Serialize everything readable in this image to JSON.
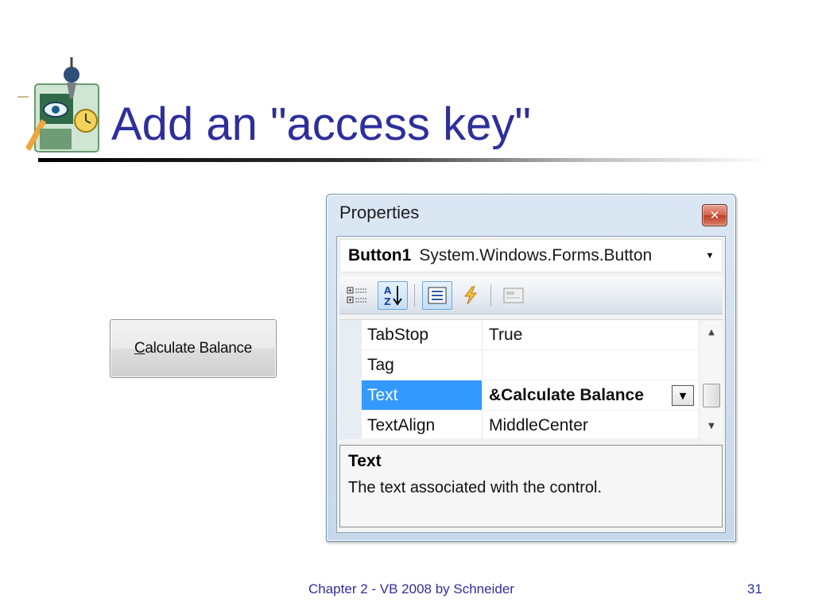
{
  "slide": {
    "title": "Add an \"access key\"",
    "footer": "Chapter 2 - VB 2008 by Schneider",
    "page_number": "31"
  },
  "sample_button": {
    "mnemonic": "C",
    "rest": "alculate Balance"
  },
  "properties_window": {
    "title": "Properties",
    "close_glyph": "✕",
    "object": {
      "name": "Button1",
      "type": "System.Windows.Forms.Button",
      "dropdown_glyph": "▼"
    },
    "toolbar": {
      "categorized_icon": "categorized-icon",
      "alphabetical_icon": "alphabetical-icon",
      "properties_icon": "properties-icon",
      "events_icon": "events-icon",
      "property_pages_icon": "property-pages-icon"
    },
    "rows": [
      {
        "name": "TabStop",
        "value": "True"
      },
      {
        "name": "Tag",
        "value": ""
      },
      {
        "name": "Text",
        "value": "&Calculate Balance",
        "selected": true
      },
      {
        "name": "TextAlign",
        "value": "MiddleCenter"
      }
    ],
    "value_dropdown_glyph": "▼",
    "scroll_up_glyph": "▲",
    "scroll_down_glyph": "▼",
    "description": {
      "title": "Text",
      "text": "The text associated with the control."
    },
    "colors": {
      "selection": "#3399ff",
      "title_accent": "#2e2f9c"
    }
  }
}
